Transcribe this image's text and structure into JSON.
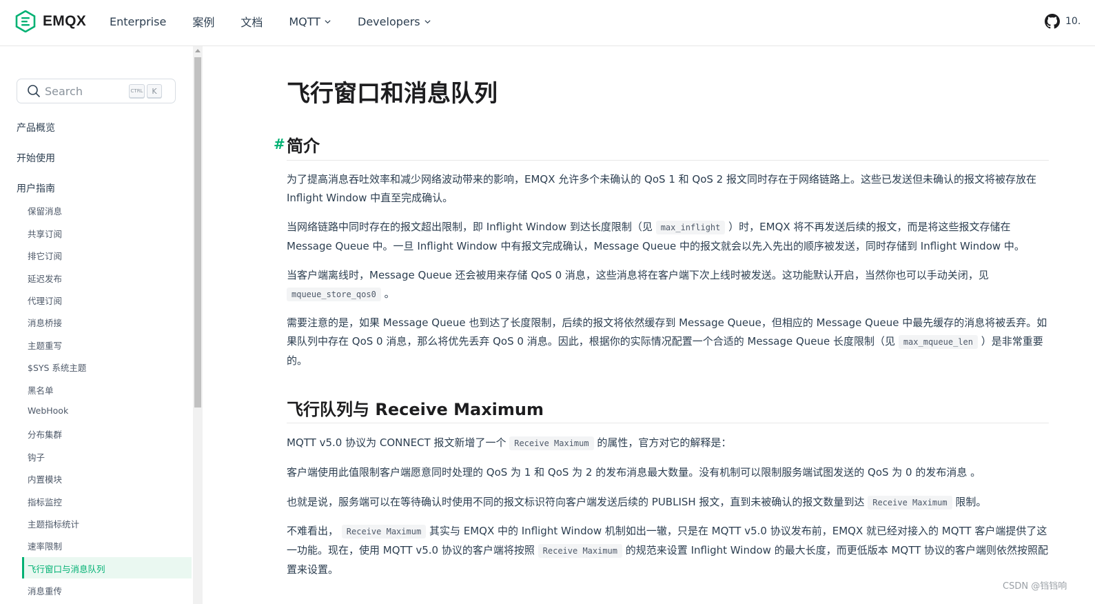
{
  "nav": {
    "brand": "EMQX",
    "links": [
      "Enterprise",
      "案例",
      "文档",
      "MQTT",
      "Developers"
    ],
    "github_text": "10."
  },
  "sidebar": {
    "search_placeholder": "Search",
    "kbd_ctrl": "CTRL",
    "kbd_k": "K",
    "sections": [
      "产品概览",
      "开始使用",
      "用户指南"
    ],
    "items": [
      "保留消息",
      "共享订阅",
      "排它订阅",
      "延迟发布",
      "代理订阅",
      "消息桥接",
      "主题重写",
      "$SYS 系统主题",
      "黑名单",
      "WebHook",
      "分布集群",
      "钩子",
      "内置模块",
      "指标监控",
      "主题指标统计",
      "速率限制",
      "飞行窗口与消息队列",
      "消息重传"
    ],
    "active_index": 16
  },
  "article": {
    "title": "飞行窗口和消息队列",
    "anchor": "#",
    "h2_intro": "简介",
    "p1": "为了提高消息吞吐效率和减少网络波动带来的影响，EMQX 允许多个未确认的 QoS 1 和 QoS 2 报文同时存在于网络链路上。这些已发送但未确认的报文将被存放在 Inflight Window 中直至完成确认。",
    "p2a": "当网络链路中同时存在的报文超出限制，即 Inflight Window 到达长度限制（见",
    "p2_code": "max_inflight",
    "p2b": "）时，EMQX 将不再发送后续的报文，而是将这些报文存储在 Message Queue 中。一旦 Inflight Window 中有报文完成确认，Message Queue 中的报文就会以先入先出的顺序被发送，同时存储到 Inflight Window 中。",
    "p3a": "当客户端离线时，Message Queue 还会被用来存储 QoS 0 消息，这些消息将在客户端下次上线时被发送。这功能默认开启，当然你也可以手动关闭，见",
    "p3_code": "mqueue_store_qos0",
    "p3b": "。",
    "p4a": "需要注意的是，如果 Message Queue 也到达了长度限制，后续的报文将依然缓存到 Message Queue，但相应的 Message Queue 中最先缓存的消息将被丢弃。如果队列中存在 QoS 0 消息，那么将优先丢弃 QoS 0 消息。因此，根据你的实际情况配置一个合适的 Message Queue 长度限制（见",
    "p4_code": "max_mqueue_len",
    "p4b": "）是非常重要的。",
    "h2_rm": "飞行队列与 Receive Maximum",
    "p5a": "MQTT v5.0 协议为 CONNECT 报文新增了一个",
    "p5_code": "Receive Maximum",
    "p5b": "的属性，官方对它的解释是：",
    "p6": "客户端使用此值限制客户端愿意同时处理的 QoS 为 1 和 QoS 为 2 的发布消息最大数量。没有机制可以限制服务端试图发送的 QoS 为 0 的发布消息 。",
    "p7a": "也就是说，服务端可以在等待确认时使用不同的报文标识符向客户端发送后续的 PUBLISH 报文，直到未被确认的报文数量到达",
    "p7_code": "Receive Maximum",
    "p7b": "限制。",
    "p8a": "不难看出，",
    "p8_code1": "Receive Maximum",
    "p8b": "其实与 EMQX 中的 Inflight Window 机制如出一辙，只是在 MQTT v5.0 协议发布前，EMQX 就已经对接入的 MQTT 客户端提供了这一功能。现在，使用 MQTT v5.0 协议的客户端将按照",
    "p8_code2": "Receive Maximum",
    "p8c": "的规范来设置 Inflight Window 的最大长度，而更低版本 MQTT 协议的客户端则依然按照配置来设置。"
  },
  "watermark": "CSDN @铛铛响",
  "colors": {
    "brand_green": "#00b173"
  }
}
